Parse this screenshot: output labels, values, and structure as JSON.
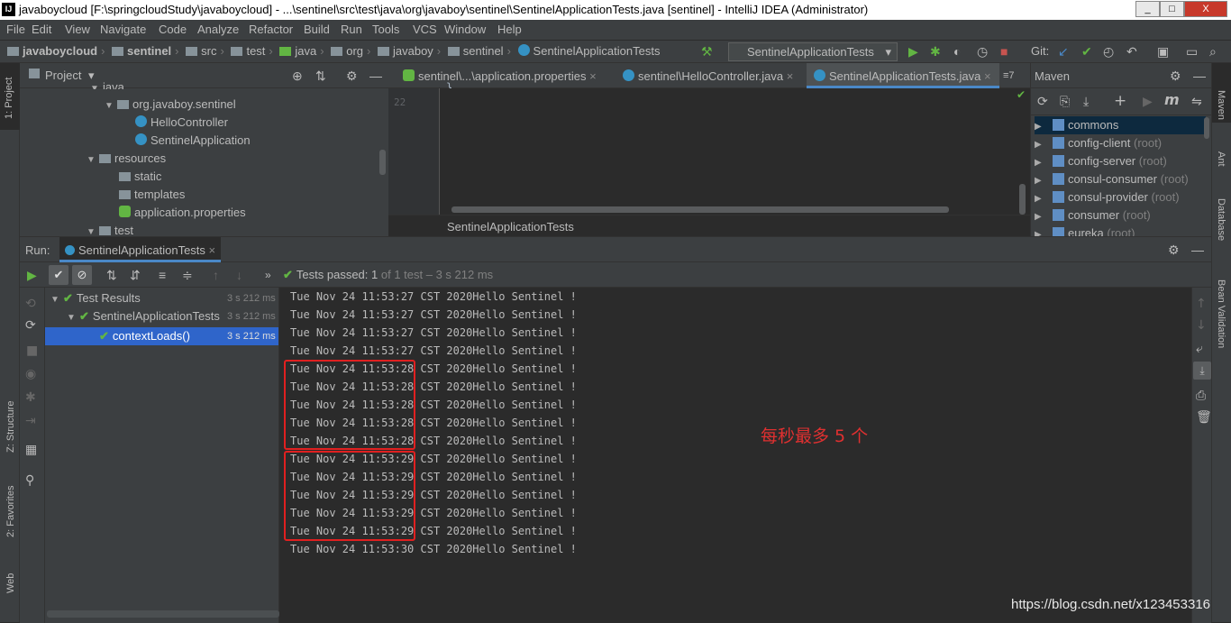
{
  "window": {
    "logo": "IJ",
    "title": "javaboycloud [F:\\springcloudStudy\\javaboycloud] - ...\\sentinel\\src\\test\\java\\org\\javaboy\\sentinel\\SentinelApplicationTests.java [sentinel] - IntelliJ IDEA (Administrator)",
    "minimize": "_",
    "maximize": "□",
    "close": "X"
  },
  "menu": [
    "File",
    "Edit",
    "View",
    "Navigate",
    "Code",
    "Analyze",
    "Refactor",
    "Build",
    "Run",
    "Tools",
    "VCS",
    "Window",
    "Help"
  ],
  "nav": {
    "crumbs": [
      "javaboycloud",
      "sentinel",
      "src",
      "test",
      "java",
      "org",
      "javaboy",
      "sentinel",
      "SentinelApplicationTests"
    ],
    "run_config": "SentinelApplicationTests",
    "git_label": "Git:"
  },
  "left_strip": {
    "project": "1: Project",
    "structure": "Z: Structure",
    "favorites": "2: Favorites",
    "web": "Web"
  },
  "right_strip": {
    "maven": "Maven",
    "ant": "Ant",
    "database": "Database",
    "bean": "Bean Validation"
  },
  "project": {
    "title": "Project",
    "items": [
      {
        "label": "java",
        "level": 5
      },
      {
        "label": "org.javaboy.sentinel",
        "level": 6
      },
      {
        "label": "HelloController",
        "level": 7
      },
      {
        "label": "SentinelApplication",
        "level": 7
      },
      {
        "label": "resources",
        "level": 5
      },
      {
        "label": "static",
        "level": 6
      },
      {
        "label": "templates",
        "level": 6
      },
      {
        "label": "application.properties",
        "level": 6
      },
      {
        "label": "test",
        "level": 4
      }
    ]
  },
  "editor": {
    "tabs": [
      {
        "label": "sentinel\\...\\application.properties",
        "active": false
      },
      {
        "label": "sentinel\\HelloController.java",
        "active": false
      },
      {
        "label": "SentinelApplicationTests.java",
        "active": true
      }
    ],
    "tab_overflow": "≡7",
    "line_number": "22",
    "code_line": "}",
    "breadcrumb": "SentinelApplicationTests"
  },
  "maven": {
    "title": "Maven",
    "items": [
      {
        "label": "commons",
        "suffix": "",
        "selected": true
      },
      {
        "label": "config-client",
        "suffix": "(root)",
        "selected": false
      },
      {
        "label": "config-server",
        "suffix": "(root)",
        "selected": false
      },
      {
        "label": "consul-consumer",
        "suffix": "(root)",
        "selected": false
      },
      {
        "label": "consul-provider",
        "suffix": "(root)",
        "selected": false
      },
      {
        "label": "consumer",
        "suffix": "(root)",
        "selected": false
      },
      {
        "label": "eureka",
        "suffix": "(root)",
        "selected": false
      }
    ]
  },
  "run": {
    "label": "Run:",
    "tab": "SentinelApplicationTests",
    "status_prefix": "Tests passed:",
    "status_count": "1",
    "status_detail": "of 1 test – 3 s 212 ms",
    "tree": [
      {
        "label": "Test Results",
        "time": "3 s 212 ms"
      },
      {
        "label": "SentinelApplicationTests",
        "time": "3 s 212 ms"
      },
      {
        "label": "contextLoads()",
        "time": "3 s 212 ms"
      }
    ],
    "console_lines": [
      "Tue Nov 24 11:53:27 CST 2020Hello Sentinel !",
      "Tue Nov 24 11:53:27 CST 2020Hello Sentinel !",
      "Tue Nov 24 11:53:27 CST 2020Hello Sentinel !",
      "Tue Nov 24 11:53:27 CST 2020Hello Sentinel !",
      "Tue Nov 24 11:53:28 CST 2020Hello Sentinel !",
      "Tue Nov 24 11:53:28 CST 2020Hello Sentinel !",
      "Tue Nov 24 11:53:28 CST 2020Hello Sentinel !",
      "Tue Nov 24 11:53:28 CST 2020Hello Sentinel !",
      "Tue Nov 24 11:53:28 CST 2020Hello Sentinel !",
      "Tue Nov 24 11:53:29 CST 2020Hello Sentinel !",
      "Tue Nov 24 11:53:29 CST 2020Hello Sentinel !",
      "Tue Nov 24 11:53:29 CST 2020Hello Sentinel !",
      "Tue Nov 24 11:53:29 CST 2020Hello Sentinel !",
      "Tue Nov 24 11:53:29 CST 2020Hello Sentinel !",
      "Tue Nov 24 11:53:30 CST 2020Hello Sentinel !"
    ],
    "annotation": "每秒最多 5 个"
  },
  "watermark": "https://blog.csdn.net/x123453316",
  "colors": {
    "accent": "#4a88c7",
    "pass": "#62b543",
    "highlight": "#e02020"
  }
}
